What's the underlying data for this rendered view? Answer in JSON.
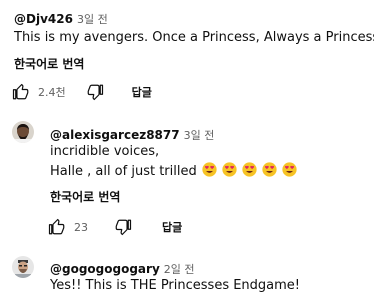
{
  "comments": [
    {
      "author": "@Djv426",
      "time": "3일 전",
      "text": "This is my avengers. Once a Princess, Always a Princess.",
      "translate_label": "한국어로 번역",
      "likes": "2.4천",
      "reply_label": "답글"
    },
    {
      "author": "@alexisgarcez8877",
      "time": "3일 전",
      "text_line1": "incridible voices,",
      "text_line2": "Halle , all of just trilled",
      "emoji": [
        "smiling-face-with-heart-eyes",
        "smiling-face-with-heart-eyes",
        "smiling-face-with-heart-eyes",
        "smiling-face-with-heart-eyes",
        "smiling-face-with-heart-eyes"
      ],
      "translate_label": "한국어로 번역",
      "likes": "23",
      "reply_label": "답글"
    },
    {
      "author": "@gogogogogary",
      "time": "2일 전",
      "text": "Yes!!  This is THE Princesses Endgame!"
    }
  ],
  "icons": {
    "like": "thumbs-up-icon",
    "dislike": "thumbs-down-icon"
  },
  "colors": {
    "text": "#0f0f0f",
    "secondary": "#606060",
    "emoji_face": "#f7c325",
    "emoji_heart": "#e0245e"
  }
}
